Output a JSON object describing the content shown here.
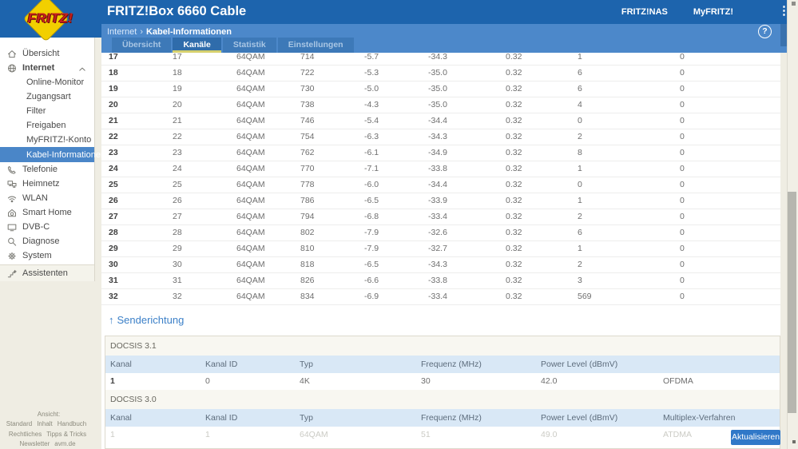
{
  "logo": {
    "text": "FRITZ!"
  },
  "header": {
    "title": "FRITZ!Box 6660 Cable",
    "links": [
      "FRITZ!NAS",
      "MyFRITZ!"
    ],
    "menu_icon": "⋮"
  },
  "breadcrumb": {
    "items": [
      "Internet",
      "Kabel-Informationen"
    ],
    "separator": "›"
  },
  "tabs": {
    "items": [
      {
        "label": "Übersicht",
        "active": false
      },
      {
        "label": "Kanäle",
        "active": true
      },
      {
        "label": "Statistik",
        "active": false
      },
      {
        "label": "Einstellungen",
        "active": false
      }
    ],
    "active_underline_color": "#d6d06e"
  },
  "help": {
    "label": "?"
  },
  "sidebar": {
    "items": [
      {
        "label": "Übersicht",
        "icon": "home-icon",
        "type": "top"
      },
      {
        "label": "Internet",
        "icon": "globe-icon",
        "type": "top",
        "bold": true,
        "expanded": true
      },
      {
        "label": "Online-Monitor",
        "type": "sub"
      },
      {
        "label": "Zugangsart",
        "type": "sub"
      },
      {
        "label": "Filter",
        "type": "sub"
      },
      {
        "label": "Freigaben",
        "type": "sub"
      },
      {
        "label": "MyFRITZ!-Konto",
        "type": "sub"
      },
      {
        "label": "Kabel-Informationen",
        "type": "sub",
        "selected": true
      },
      {
        "label": "Telefonie",
        "icon": "phone-icon",
        "type": "top"
      },
      {
        "label": "Heimnetz",
        "icon": "devices-icon",
        "type": "top"
      },
      {
        "label": "WLAN",
        "icon": "wifi-icon",
        "type": "top"
      },
      {
        "label": "Smart Home",
        "icon": "smarthome-icon",
        "type": "top"
      },
      {
        "label": "DVB-C",
        "icon": "tv-icon",
        "type": "top"
      },
      {
        "label": "Diagnose",
        "icon": "magnifier-icon",
        "type": "top"
      },
      {
        "label": "System",
        "icon": "gear-icon",
        "type": "top"
      },
      {
        "label": "Assistenten",
        "icon": "wizard-icon",
        "type": "assist"
      }
    ],
    "selected_color": "#4a86c8"
  },
  "channel_table": {
    "rows": [
      [
        "17",
        "17",
        "64QAM",
        "714",
        "-5.7",
        "-34.3",
        "0.32",
        "1",
        "0"
      ],
      [
        "18",
        "18",
        "64QAM",
        "722",
        "-5.3",
        "-35.0",
        "0.32",
        "6",
        "0"
      ],
      [
        "19",
        "19",
        "64QAM",
        "730",
        "-5.0",
        "-35.0",
        "0.32",
        "6",
        "0"
      ],
      [
        "20",
        "20",
        "64QAM",
        "738",
        "-4.3",
        "-35.0",
        "0.32",
        "4",
        "0"
      ],
      [
        "21",
        "21",
        "64QAM",
        "746",
        "-5.4",
        "-34.4",
        "0.32",
        "0",
        "0"
      ],
      [
        "22",
        "22",
        "64QAM",
        "754",
        "-6.3",
        "-34.3",
        "0.32",
        "2",
        "0"
      ],
      [
        "23",
        "23",
        "64QAM",
        "762",
        "-6.1",
        "-34.9",
        "0.32",
        "8",
        "0"
      ],
      [
        "24",
        "24",
        "64QAM",
        "770",
        "-7.1",
        "-33.8",
        "0.32",
        "1",
        "0"
      ],
      [
        "25",
        "25",
        "64QAM",
        "778",
        "-6.0",
        "-34.4",
        "0.32",
        "0",
        "0"
      ],
      [
        "26",
        "26",
        "64QAM",
        "786",
        "-6.5",
        "-33.9",
        "0.32",
        "1",
        "0"
      ],
      [
        "27",
        "27",
        "64QAM",
        "794",
        "-6.8",
        "-33.4",
        "0.32",
        "2",
        "0"
      ],
      [
        "28",
        "28",
        "64QAM",
        "802",
        "-7.9",
        "-32.6",
        "0.32",
        "6",
        "0"
      ],
      [
        "29",
        "29",
        "64QAM",
        "810",
        "-7.9",
        "-32.7",
        "0.32",
        "1",
        "0"
      ],
      [
        "30",
        "30",
        "64QAM",
        "818",
        "-6.5",
        "-34.3",
        "0.32",
        "2",
        "0"
      ],
      [
        "31",
        "31",
        "64QAM",
        "826",
        "-6.6",
        "-33.8",
        "0.32",
        "3",
        "0"
      ],
      [
        "32",
        "32",
        "64QAM",
        "834",
        "-6.9",
        "-33.4",
        "0.32",
        "569",
        "0"
      ]
    ]
  },
  "upstream": {
    "heading_arrow": "↑",
    "heading_label": "Senderichtung",
    "sections": [
      {
        "title": "DOCSIS 3.1",
        "headers": [
          "Kanal",
          "Kanal ID",
          "Typ",
          "Frequenz (MHz)",
          "Power Level (dBmV)",
          ""
        ],
        "rows": [
          [
            "1",
            "0",
            "4K",
            "30",
            "42.0",
            "OFDMA"
          ]
        ],
        "faded": false
      },
      {
        "title": "DOCSIS 3.0",
        "headers": [
          "Kanal",
          "Kanal ID",
          "Typ",
          "Frequenz (MHz)",
          "Power Level (dBmV)",
          "Multiplex-Verfahren"
        ],
        "rows": [
          [
            "1",
            "1",
            "64QAM",
            "51",
            "49.0",
            "ATDMA"
          ]
        ],
        "faded": true
      }
    ]
  },
  "actions": {
    "refresh_label": "Aktualisieren"
  },
  "footer": {
    "lines": [
      [
        "Ansicht: Standard",
        "Inhalt",
        "Handbuch"
      ],
      [
        "Rechtliches",
        "Tipps & Tricks"
      ],
      [
        "Newsletter",
        "avm.de"
      ]
    ]
  },
  "colors": {
    "header_blue": "#1d64ad",
    "band_blue": "#4c88ca",
    "tab_blue": "#3d79b8",
    "tab_active_blue": "#2f6cab",
    "selected_blue": "#4a86c8",
    "link_blue": "#3c80c8",
    "table_head_bg": "#d9e8f6",
    "button_blue": "#3078c8",
    "logo_yellow": "#f2cf00",
    "logo_red": "#c6201c"
  }
}
